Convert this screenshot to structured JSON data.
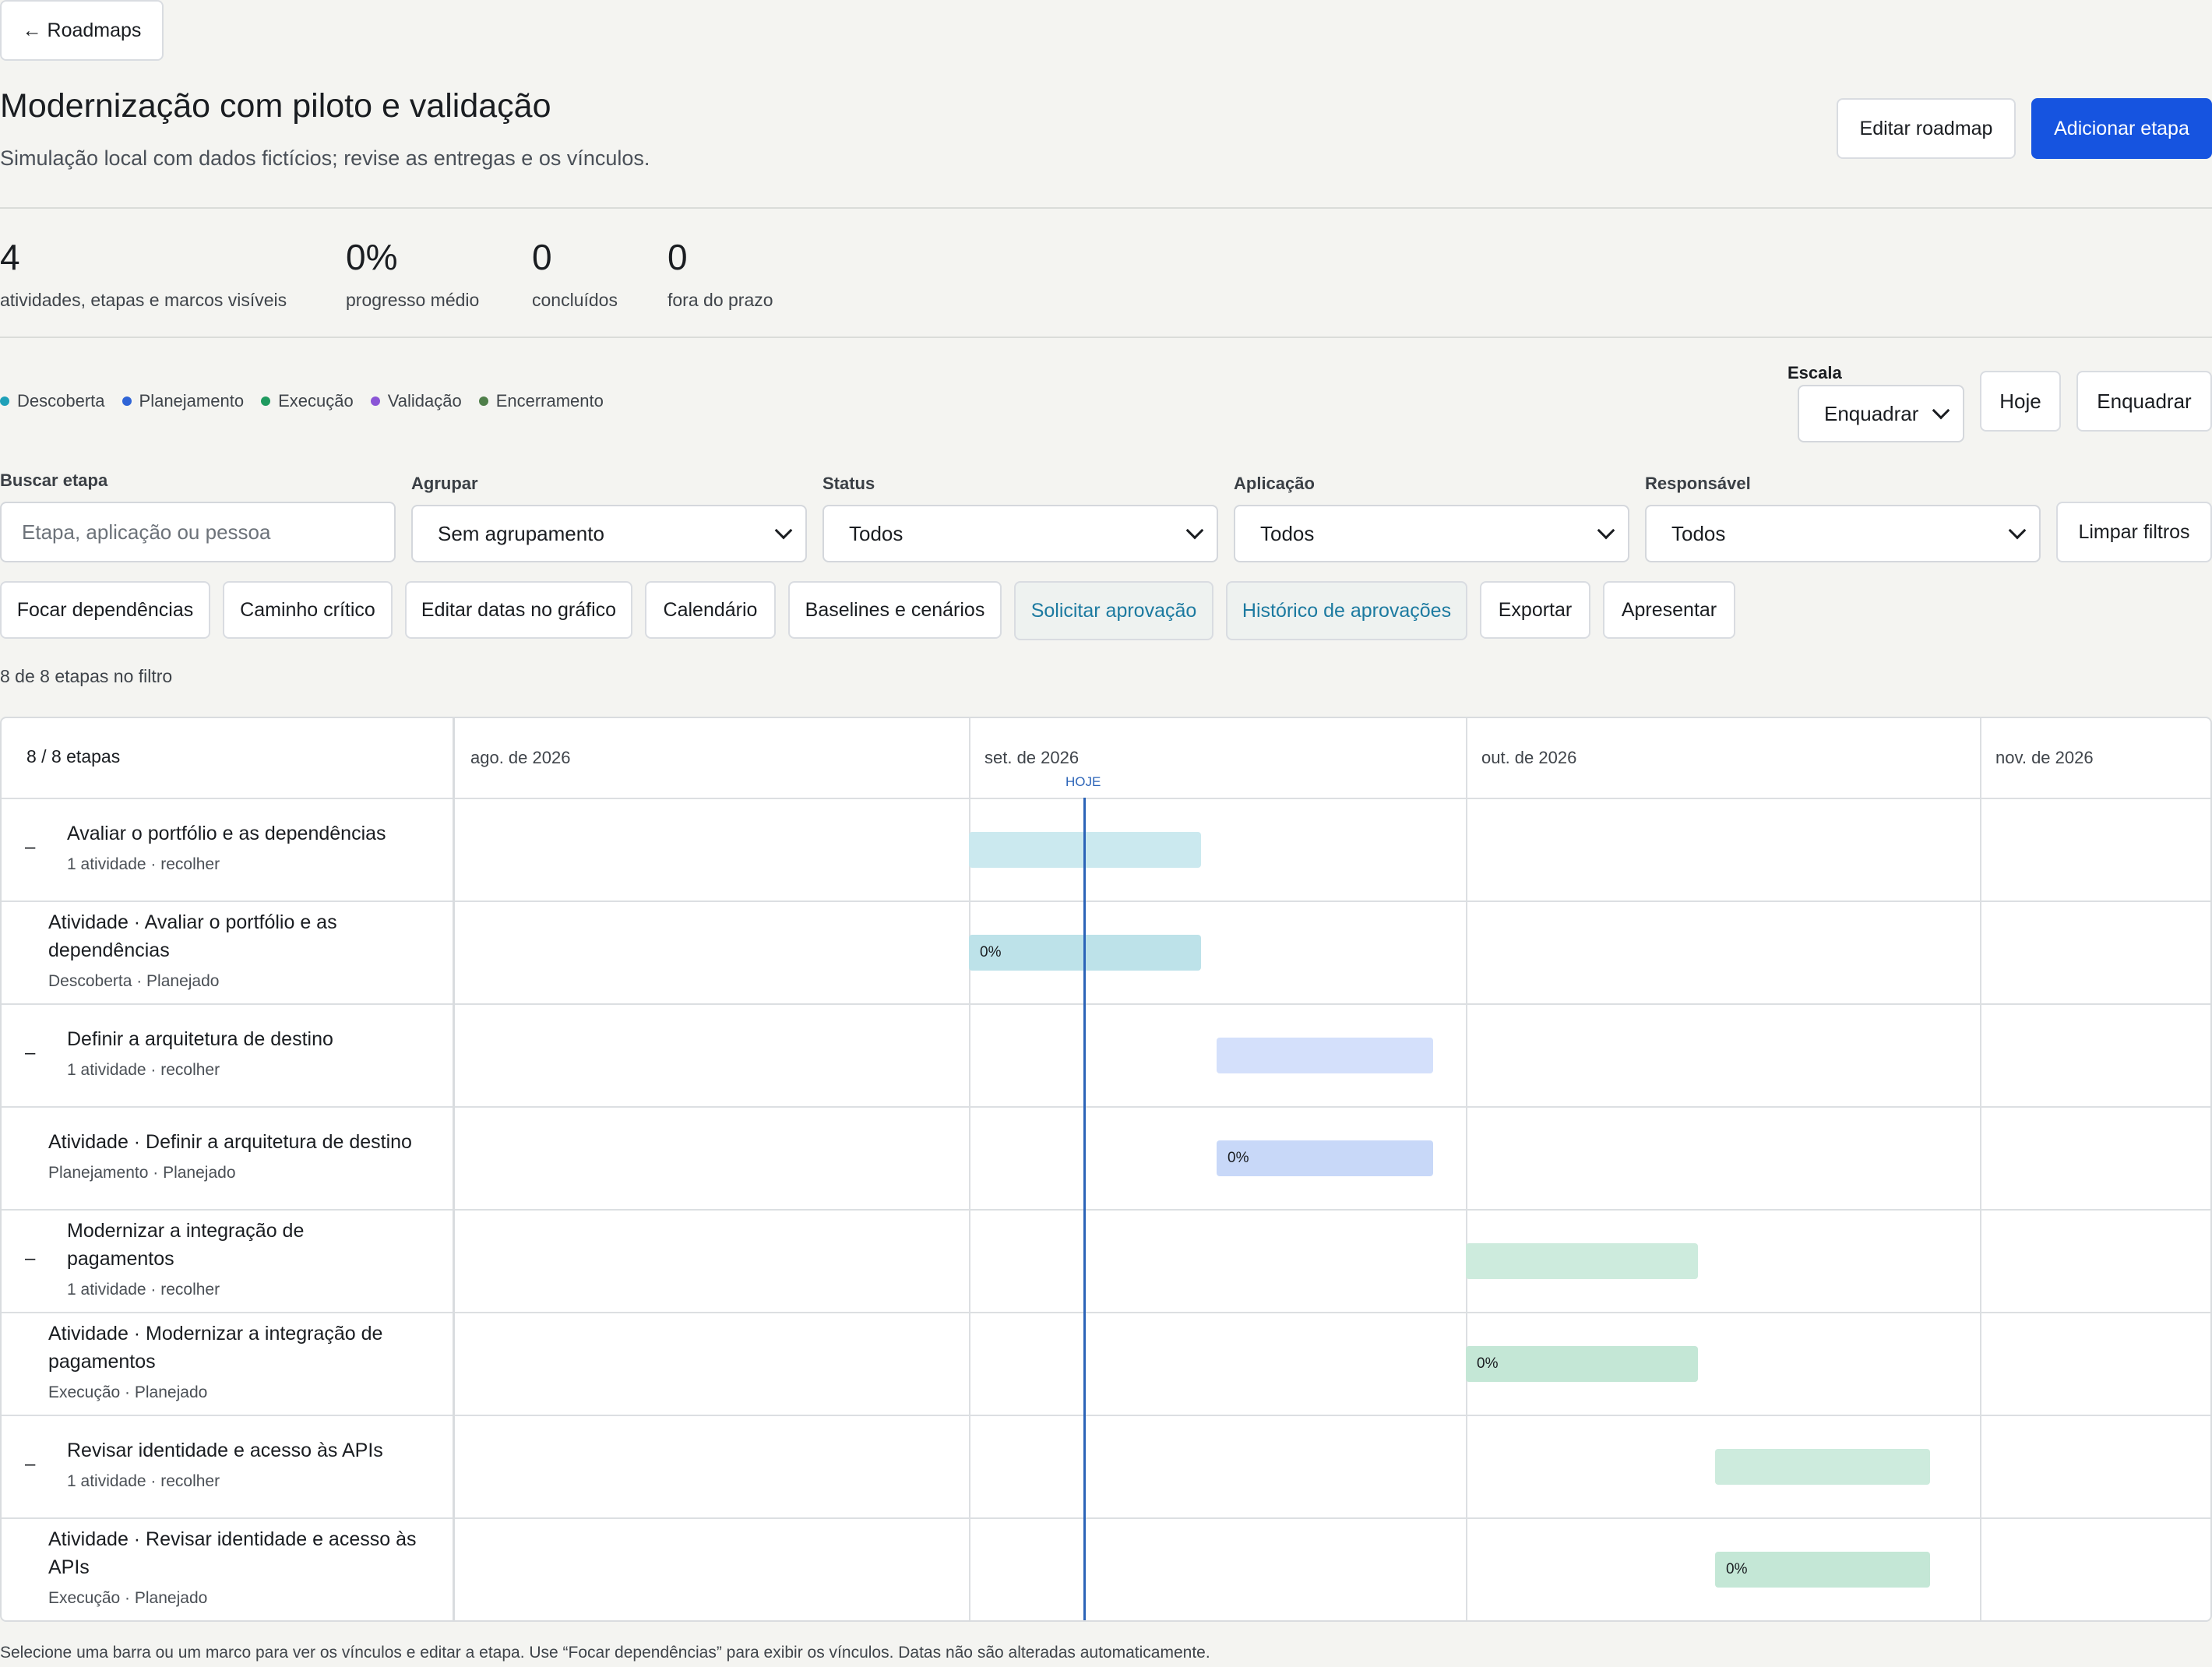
{
  "nav": {
    "back_label": "← Roadmaps"
  },
  "header": {
    "title": "Modernização com piloto e validação",
    "subtitle": "Simulação local com dados fictícios; revise as entregas e os vínculos.",
    "edit_button": "Editar roadmap",
    "add_button": "Adicionar etapa"
  },
  "stats": [
    {
      "value": "4",
      "label": "atividades, etapas e marcos visíveis"
    },
    {
      "value": "0%",
      "label": "progresso médio"
    },
    {
      "value": "0",
      "label": "concluídos"
    },
    {
      "value": "0",
      "label": "fora do prazo"
    }
  ],
  "legend": [
    {
      "label": "Descoberta",
      "color": "#1fa0b8"
    },
    {
      "label": "Planejamento",
      "color": "#2f64d6"
    },
    {
      "label": "Execução",
      "color": "#1f9a5f"
    },
    {
      "label": "Validação",
      "color": "#8a55d6"
    },
    {
      "label": "Encerramento",
      "color": "#4f7f4a"
    }
  ],
  "scale": {
    "label": "Escala",
    "value": "Enquadrar",
    "today_button": "Hoje",
    "fit_button": "Enquadrar"
  },
  "filters": {
    "search": {
      "label": "Buscar etapa",
      "placeholder": "Etapa, aplicação ou pessoa",
      "value": ""
    },
    "group": {
      "label": "Agrupar",
      "value": "Sem agrupamento"
    },
    "status": {
      "label": "Status",
      "value": "Todos"
    },
    "application": {
      "label": "Aplicação",
      "value": "Todos"
    },
    "owner": {
      "label": "Responsável",
      "value": "Todos"
    },
    "clear_button": "Limpar filtros"
  },
  "actions": [
    "Focar dependências",
    "Caminho crítico",
    "Editar datas no gráfico",
    "Calendário",
    "Baselines e cenários",
    "Solicitar aprovação",
    "Histórico de aprovações",
    "Exportar",
    "Apresentar"
  ],
  "filter_count": "8 de 8 etapas no filtro",
  "gantt": {
    "header_count": "8 / 8 etapas",
    "months": [
      "ago. de 2026",
      "set. de 2026",
      "out. de 2026",
      "nov. de 2026"
    ],
    "today_label": "HOJE",
    "rows": [
      {
        "type": "group",
        "toggle": "–",
        "title": "Avaliar o portfólio e as dependências",
        "sub": "1 atividade · recolher",
        "color": "#cbe9ef"
      },
      {
        "type": "task",
        "title": "Atividade · Avaliar o portfólio e as dependências",
        "sub": "Descoberta · Planejado",
        "progress": "0%",
        "color": "#bde2e9"
      },
      {
        "type": "group",
        "toggle": "–",
        "title": "Definir a arquitetura de destino",
        "sub": "1 atividade · recolher",
        "color": "#d4e0fb"
      },
      {
        "type": "task",
        "title": "Atividade · Definir a arquitetura de destino",
        "sub": "Planejamento · Planejado",
        "progress": "0%",
        "color": "#c8d8f8"
      },
      {
        "type": "group",
        "toggle": "–",
        "title": "Modernizar a integração de pagamentos",
        "sub": "1 atividade · recolher",
        "color": "#cdebdd"
      },
      {
        "type": "task",
        "title": "Atividade · Modernizar a integração de pagamentos",
        "sub": "Execução · Planejado",
        "progress": "0%",
        "color": "#c4e7d6"
      },
      {
        "type": "group",
        "toggle": "–",
        "title": "Revisar identidade e acesso às APIs",
        "sub": "1 atividade · recolher",
        "color": "#cdebdd"
      },
      {
        "type": "task",
        "title": "Atividade · Revisar identidade e acesso às APIs",
        "sub": "Execução · Planejado",
        "progress": "0%",
        "color": "#c4e7d6"
      }
    ]
  },
  "footer_note": "Selecione uma barra ou um marco para ver os vínculos e editar a etapa. Use “Focar dependências” para exibir os vínculos. Datas não são alteradas automaticamente."
}
